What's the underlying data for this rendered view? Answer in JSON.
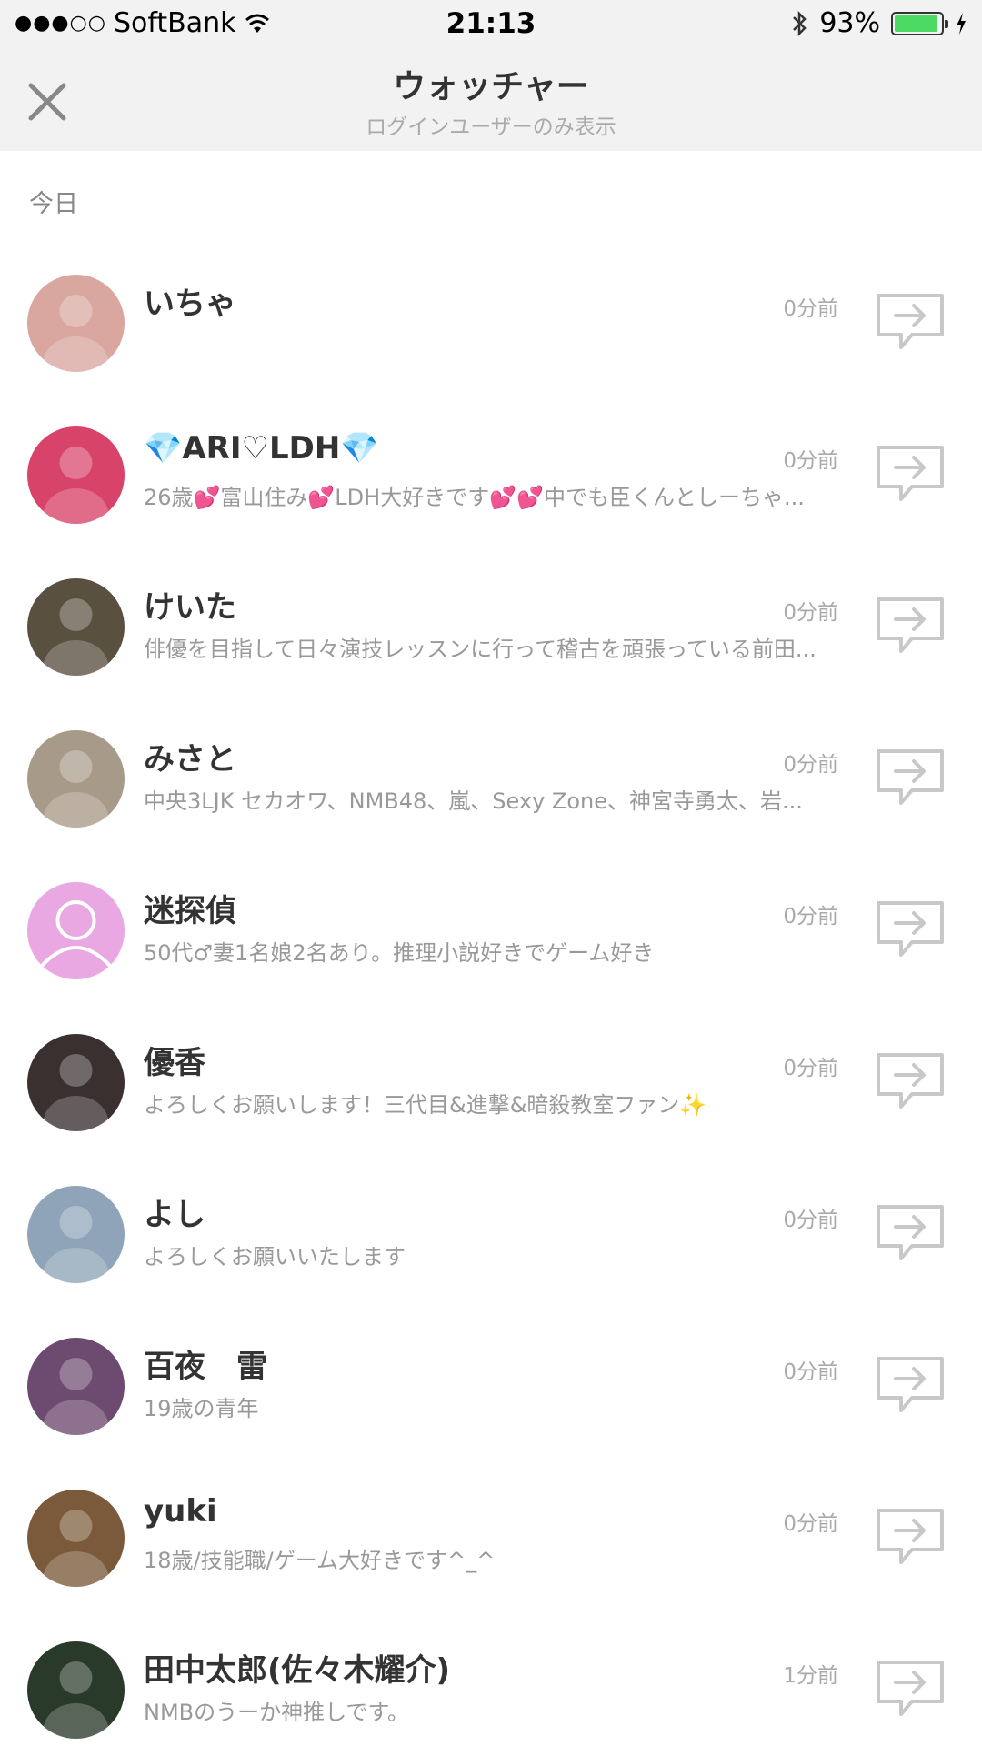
{
  "status": {
    "signal": "●●●○○",
    "carrier": "SoftBank",
    "time": "21:13",
    "battery": "93%",
    "battery_color": "#4cd964"
  },
  "header": {
    "title": "ウォッチャー",
    "subtitle": "ログインユーザーのみ表示",
    "close_icon": "close-icon"
  },
  "section": {
    "label": "今日"
  },
  "users": [
    {
      "name": "いちゃ",
      "bio": "",
      "time": "0分前",
      "avatar_color": "#d9a7a0"
    },
    {
      "name": "💎ARI♡LDH💎",
      "bio": "26歳💕富山住み💕LDH大好きです💕💕中でも臣くんとしーちゃ...",
      "time": "0分前",
      "avatar_color": "#d8436a"
    },
    {
      "name": "けいた",
      "bio": "俳優を目指して日々演技レッスンに行って稽古を頑張っている前田...",
      "time": "0分前",
      "avatar_color": "#5a5040"
    },
    {
      "name": "みさと",
      "bio": "中央3LJK セカオワ、NMB48、嵐、Sexy Zone、神宮寺勇太、岩...",
      "time": "0分前",
      "avatar_color": "#a89a88"
    },
    {
      "name": "迷探偵",
      "bio": "50代♂妻1名娘2名あり。推理小説好きでゲーム好き",
      "time": "0分前",
      "avatar_color": "#eaa8e2",
      "default_avatar": true
    },
    {
      "name": "優香",
      "bio": "よろしくお願いします！三代目&進撃&暗殺教室ファン✨",
      "time": "0分前",
      "avatar_color": "#3a3030"
    },
    {
      "name": "よし",
      "bio": "よろしくお願いいたします",
      "time": "0分前",
      "avatar_color": "#8fa4b8"
    },
    {
      "name": "百夜　雷",
      "bio": "19歳の青年",
      "time": "0分前",
      "avatar_color": "#6d4a6f"
    },
    {
      "name": "yuki",
      "bio": "18歳/技能職/ゲーム大好きです^_^",
      "time": "0分前",
      "avatar_color": "#7a5a3a"
    },
    {
      "name": "田中太郎(佐々木耀介)",
      "bio": "NMBのうーか神推しです。",
      "time": "1分前",
      "avatar_color": "#2a3a2a"
    }
  ]
}
